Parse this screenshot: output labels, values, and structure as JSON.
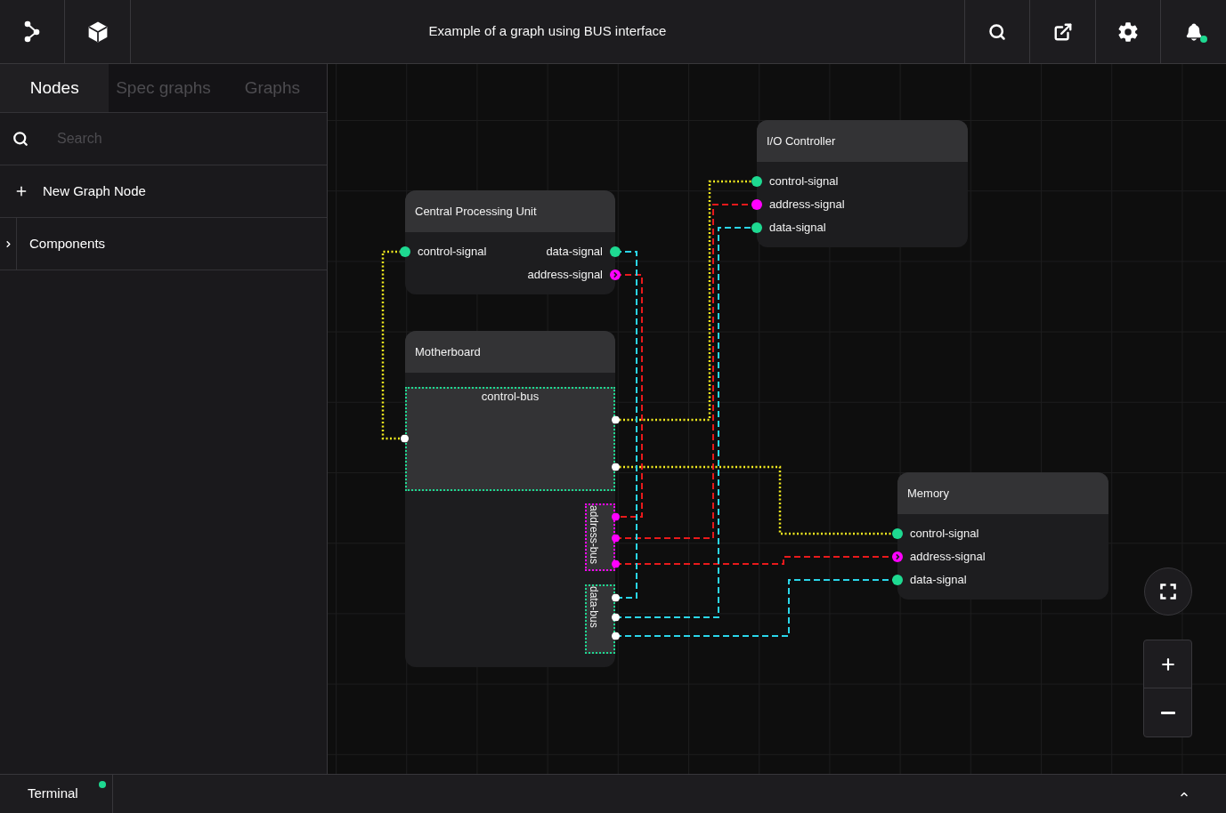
{
  "toolbar": {
    "title": "Example of a graph using BUS interface",
    "notifications": {
      "unread": true
    }
  },
  "sidebar": {
    "tabs": [
      {
        "label": "Nodes",
        "selected": true
      },
      {
        "label": "Spec graphs",
        "selected": false
      },
      {
        "label": "Graphs",
        "selected": false
      }
    ],
    "search": {
      "placeholder": "Search"
    },
    "new_node_button": "New Graph Node",
    "tree": [
      {
        "label": "Components",
        "expanded": false
      }
    ]
  },
  "canvas": {
    "nodes": [
      {
        "title": "Central Processing Unit",
        "inputs": [
          {
            "label": "control-signal",
            "color": "#1ed991",
            "kind": "dot"
          }
        ],
        "outputs": [
          {
            "label": "data-signal",
            "color": "#1ed991",
            "kind": "dot"
          },
          {
            "label": "address-signal",
            "color": "#ff00ff",
            "kind": "arrow"
          }
        ]
      },
      {
        "title": "Motherboard",
        "buses": [
          {
            "label": "control-bus",
            "color": "#1ed991",
            "ports": [
              {
                "color": "#ffffff"
              },
              {
                "color": "#ffffff"
              },
              {
                "color": "#ffffff"
              }
            ]
          },
          {
            "label": "address-bus",
            "color": "#ff00ff",
            "ports": [
              {
                "color": "#ff00ff"
              },
              {
                "color": "#ff00ff"
              },
              {
                "color": "#ff00ff"
              }
            ]
          },
          {
            "label": "data-bus",
            "color": "#1ed991",
            "ports": [
              {
                "color": "#ffffff"
              },
              {
                "color": "#ffffff"
              },
              {
                "color": "#ffffff"
              }
            ]
          }
        ]
      },
      {
        "title": "I/O Controller",
        "inputs": [
          {
            "label": "control-signal",
            "color": "#1ed991",
            "kind": "dot"
          },
          {
            "label": "address-signal",
            "color": "#ff00ff",
            "kind": "dot"
          },
          {
            "label": "data-signal",
            "color": "#1ed991",
            "kind": "dot"
          }
        ]
      },
      {
        "title": "Memory",
        "inputs": [
          {
            "label": "control-signal",
            "color": "#1ed991",
            "kind": "dot"
          },
          {
            "label": "address-signal",
            "color": "#ff00ff",
            "kind": "arrow"
          },
          {
            "label": "data-signal",
            "color": "#1ed991",
            "kind": "dot"
          }
        ]
      }
    ],
    "edges": [
      {
        "color": "#f2ea1f",
        "kind": "control"
      },
      {
        "color": "#f2ea1f",
        "kind": "control"
      },
      {
        "color": "#f2ea1f",
        "kind": "control"
      },
      {
        "color": "#e8191b",
        "kind": "address"
      },
      {
        "color": "#e8191b",
        "kind": "address"
      },
      {
        "color": "#e8191b",
        "kind": "address"
      },
      {
        "color": "#2ad6ea",
        "kind": "data"
      },
      {
        "color": "#2ad6ea",
        "kind": "data"
      },
      {
        "color": "#2ad6ea",
        "kind": "data"
      }
    ]
  },
  "bottom_panel": {
    "tabs": [
      {
        "label": "Terminal",
        "indicator": true
      }
    ],
    "expanded": false
  }
}
